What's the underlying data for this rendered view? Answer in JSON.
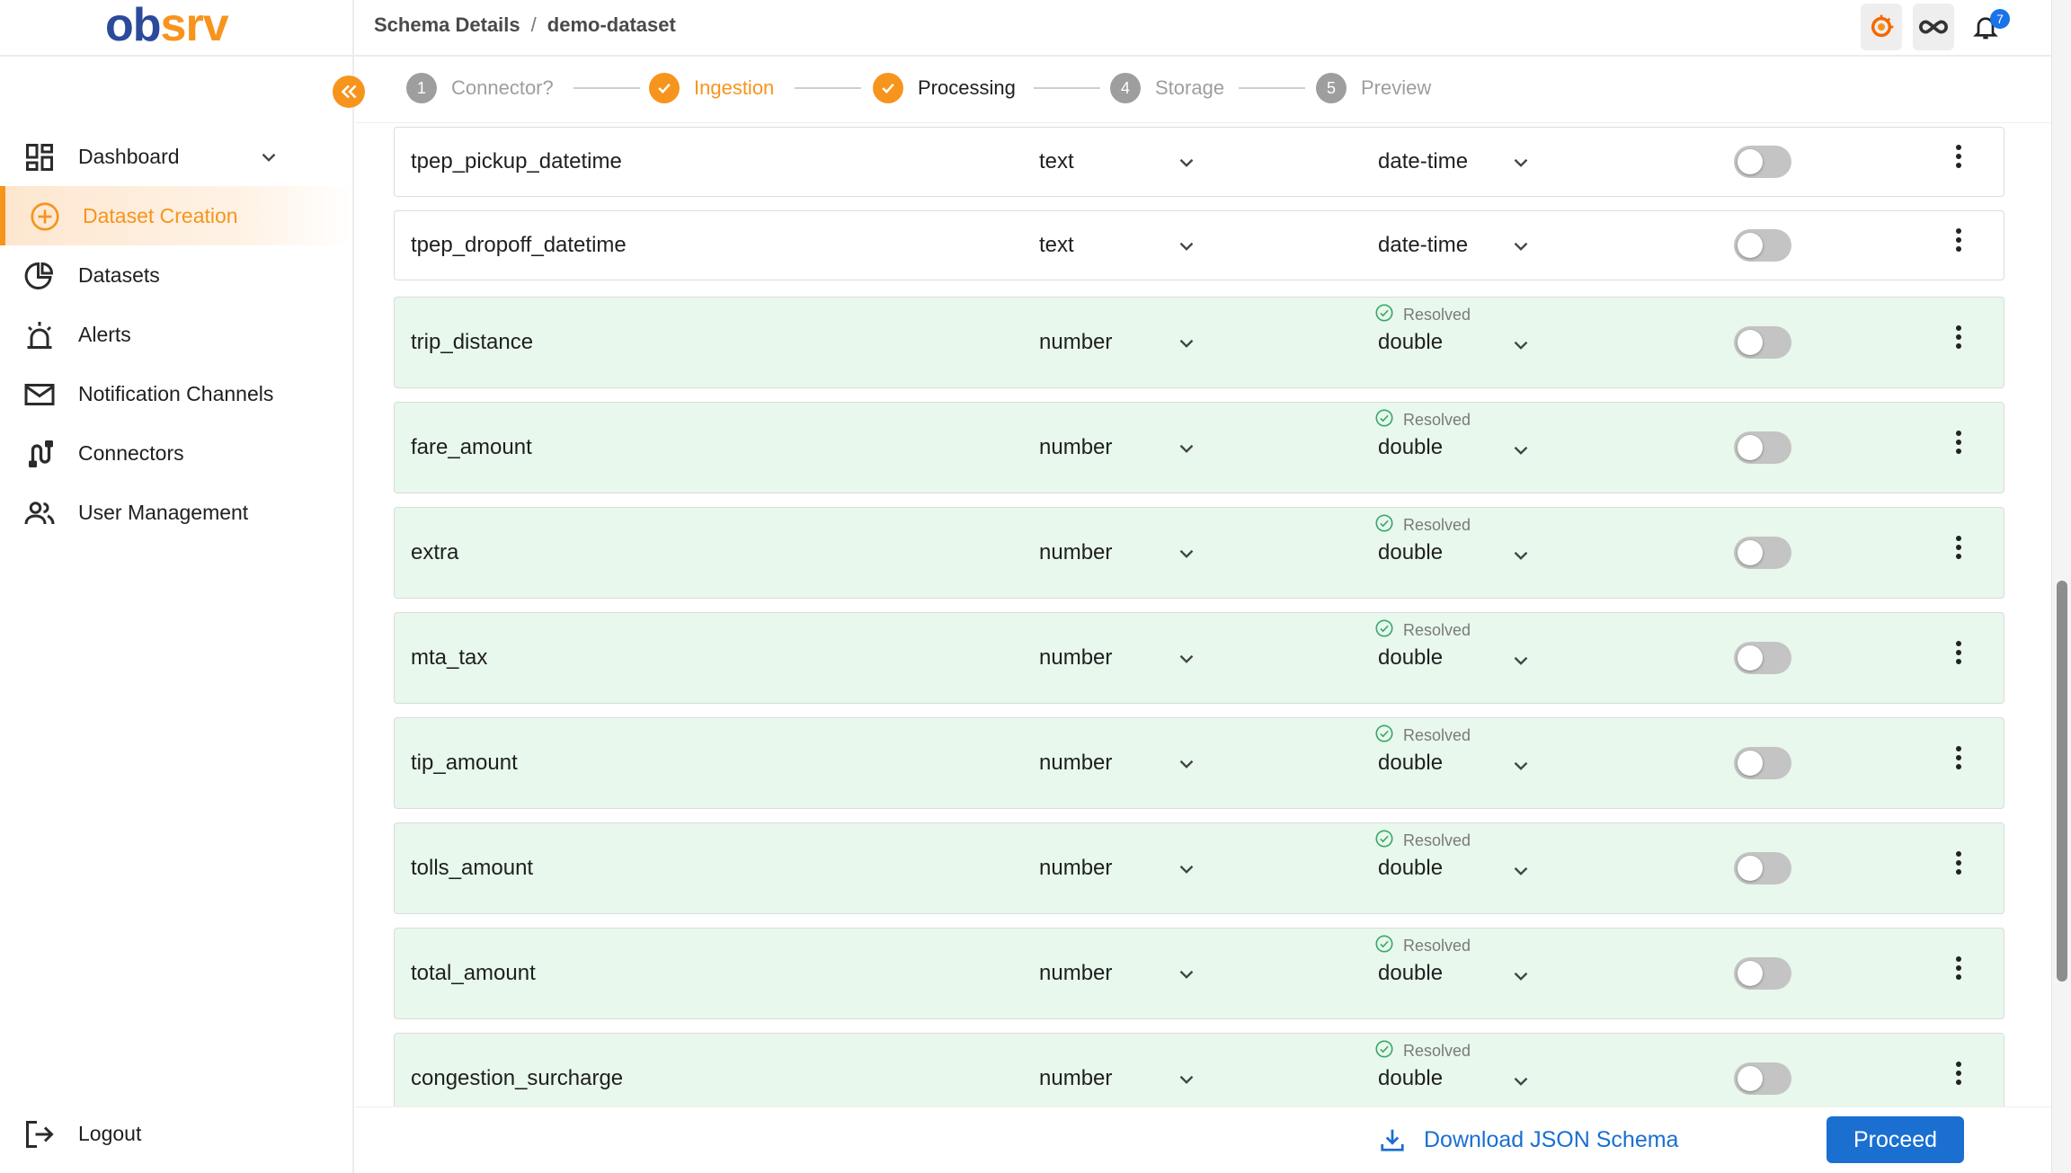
{
  "app": {
    "logo_text": "obsrv"
  },
  "header": {
    "breadcrumb": [
      "Schema Details",
      "demo-dataset"
    ],
    "breadcrumb_separator": "/",
    "notification_count": "7"
  },
  "sidebar": {
    "items": [
      {
        "label": "Dashboard",
        "icon": "dashboard-icon",
        "has_dropdown": true
      },
      {
        "label": "Dataset Creation",
        "icon": "add-circle-icon",
        "active": true
      },
      {
        "label": "Datasets",
        "icon": "pie-chart-icon"
      },
      {
        "label": "Alerts",
        "icon": "alarm-icon"
      },
      {
        "label": "Notification Channels",
        "icon": "mail-icon"
      },
      {
        "label": "Connectors",
        "icon": "connector-icon"
      },
      {
        "label": "User Management",
        "icon": "users-icon"
      }
    ],
    "logout_label": "Logout"
  },
  "stepper": {
    "steps": [
      {
        "number": "1",
        "label": "Connector?",
        "state": "pending"
      },
      {
        "number": "2",
        "label": "Ingestion",
        "state": "done"
      },
      {
        "number": "3",
        "label": "Processing",
        "state": "current"
      },
      {
        "number": "4",
        "label": "Storage",
        "state": "pending"
      },
      {
        "number": "5",
        "label": "Preview",
        "state": "pending"
      }
    ]
  },
  "schema": {
    "rows": [
      {
        "field": "tpep_pickup_datetime",
        "data_type": "text",
        "format": "date-time",
        "resolved": false,
        "required": false
      },
      {
        "field": "tpep_dropoff_datetime",
        "data_type": "text",
        "format": "date-time",
        "resolved": false,
        "required": false
      },
      {
        "field": "trip_distance",
        "data_type": "number",
        "format": "double",
        "resolved": true,
        "resolved_label": "Resolved",
        "required": false
      },
      {
        "field": "fare_amount",
        "data_type": "number",
        "format": "double",
        "resolved": true,
        "resolved_label": "Resolved",
        "required": false
      },
      {
        "field": "extra",
        "data_type": "number",
        "format": "double",
        "resolved": true,
        "resolved_label": "Resolved",
        "required": false
      },
      {
        "field": "mta_tax",
        "data_type": "number",
        "format": "double",
        "resolved": true,
        "resolved_label": "Resolved",
        "required": false
      },
      {
        "field": "tip_amount",
        "data_type": "number",
        "format": "double",
        "resolved": true,
        "resolved_label": "Resolved",
        "required": false
      },
      {
        "field": "tolls_amount",
        "data_type": "number",
        "format": "double",
        "resolved": true,
        "resolved_label": "Resolved",
        "required": false
      },
      {
        "field": "total_amount",
        "data_type": "number",
        "format": "double",
        "resolved": true,
        "resolved_label": "Resolved",
        "required": false
      },
      {
        "field": "congestion_surcharge",
        "data_type": "number",
        "format": "double",
        "resolved": true,
        "resolved_label": "Resolved",
        "required": false
      }
    ]
  },
  "footer": {
    "download_label": "Download JSON Schema",
    "proceed_label": "Proceed"
  },
  "colors": {
    "brand_orange": "#f7941d",
    "brand_blue": "#2b4a9c",
    "primary_button": "#1a6fd1",
    "resolved_row_bg": "#e8f8ec",
    "resolved_icon": "#3aa76d"
  }
}
